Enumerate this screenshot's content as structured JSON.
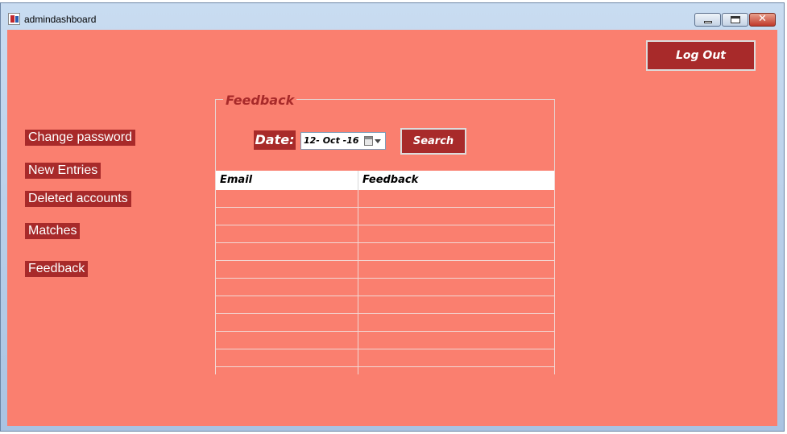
{
  "window": {
    "title": "admindashboard",
    "controls": {
      "minimize": "minimize-icon",
      "maximize": "maximize-icon",
      "close": "✕"
    }
  },
  "header": {
    "logout_label": "Log Out"
  },
  "sidebar": {
    "items": [
      {
        "label": "Change password"
      },
      {
        "label": "New Entries"
      },
      {
        "label": "Deleted accounts"
      },
      {
        "label": "Matches"
      },
      {
        "label": "Feedback"
      }
    ]
  },
  "feedback_panel": {
    "title": "Feedback",
    "date_label": "Date:",
    "date_value": "12- Oct -16",
    "search_label": "Search",
    "columns": [
      "Email",
      "Feedback"
    ],
    "rows": [
      [
        "",
        ""
      ],
      [
        "",
        ""
      ],
      [
        "",
        ""
      ],
      [
        "",
        ""
      ],
      [
        "",
        ""
      ],
      [
        "",
        ""
      ],
      [
        "",
        ""
      ],
      [
        "",
        ""
      ],
      [
        "",
        ""
      ],
      [
        "",
        ""
      ]
    ]
  },
  "colors": {
    "background": "#fa7f6f",
    "accent": "#a82a2a",
    "text_on_accent": "#ffffff"
  }
}
